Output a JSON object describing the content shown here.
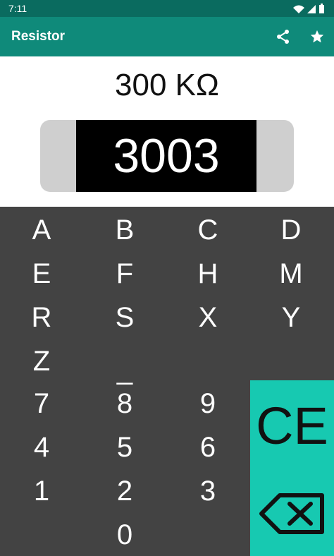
{
  "status_bar": {
    "time": "7:11",
    "icons": [
      "wifi-icon",
      "signal-icon",
      "battery-icon"
    ]
  },
  "app_bar": {
    "title": "Resistor",
    "actions": [
      "share-icon",
      "star-icon"
    ]
  },
  "display": {
    "value": "300 KΩ",
    "code": "3003"
  },
  "keypad": {
    "letters": [
      [
        "A",
        "B",
        "C",
        "D"
      ],
      [
        "E",
        "F",
        "H",
        "M"
      ],
      [
        "R",
        "S",
        "X",
        "Y"
      ],
      [
        "Z",
        "_"
      ]
    ],
    "digits": [
      [
        "7",
        "8",
        "9"
      ],
      [
        "4",
        "5",
        "6"
      ],
      [
        "1",
        "2",
        "3"
      ],
      [
        "0"
      ]
    ],
    "clear_label": "CE",
    "backspace_icon": "backspace-icon"
  },
  "colors": {
    "status_bar": "#0a6b5f",
    "app_bar": "#0f8a7a",
    "keypad_bg": "#434343",
    "accent_panel": "#17c9b1",
    "resistor_body": "#cfcfcf"
  }
}
